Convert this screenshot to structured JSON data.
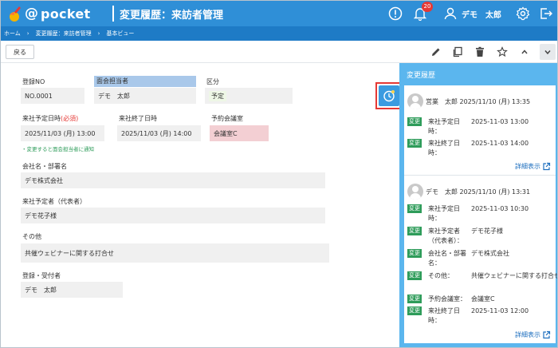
{
  "app": {
    "logo_text": "pocket",
    "logo_at": "@",
    "page_title": "変更履歴：来訪者管理",
    "notification_count": "20",
    "user_name": "デモ　太郎"
  },
  "breadcrumb": [
    "ホーム",
    "変更履歴：来訪者管理",
    "基本ビュー"
  ],
  "toolbar": {
    "back_label": "戻る"
  },
  "form": {
    "reg_no": {
      "label": "登録NO",
      "value": "NO.0001"
    },
    "host": {
      "label": "面会担当者",
      "value": "デモ　太郎"
    },
    "category": {
      "label": "区分",
      "value": "予定"
    },
    "start": {
      "label": "来社予定日時",
      "required": "(必須)",
      "value": "2025/11/03 (月) 13:00"
    },
    "end": {
      "label": "来社終了日時",
      "value": "2025/11/03 (月) 14:00"
    },
    "room": {
      "label": "予約会議室",
      "value": "会議室C"
    },
    "notice": "・変更すると面会担当者に通知",
    "company": {
      "label": "会社名・部署名",
      "value": "デモ株式会社"
    },
    "visitor": {
      "label": "来社予定者（代表者）",
      "value": "デモ花子様"
    },
    "other": {
      "label": "その他",
      "value": "共催ウェビナーに関する打合せ"
    },
    "registrar": {
      "label": "登録・受付者",
      "value": "デモ　太郎"
    }
  },
  "history": {
    "title": "変更履歴",
    "tag_label": "変更",
    "detail_label": "詳細表示",
    "cards": [
      {
        "header": "営業　太郎 2025/11/10 (月) 13:35",
        "items": [
          {
            "key": "来社予定日",
            "key2": "時：",
            "value": "2025-11-03 13:00"
          },
          {
            "key": "来社終了日",
            "key2": "時：",
            "value": "2025-11-03 14:00"
          }
        ]
      },
      {
        "header": "デモ　太郎 2025/11/10 (月) 13:31",
        "items": [
          {
            "key": "来社予定日",
            "key2": "時：",
            "value": "2025-11-03 10:30"
          },
          {
            "key": "来社予定者",
            "key2": "（代表者）：",
            "value": "デモ花子様"
          },
          {
            "key": "会社名・部署",
            "key2": "名：",
            "value": "デモ株式会社"
          },
          {
            "key": "その他：",
            "key2": "",
            "value": "共催ウェビナーに関する打合せ"
          },
          {
            "key": "予約会議室：",
            "key2": "",
            "value": "会議室C"
          },
          {
            "key": "来社終了日",
            "key2": "時：",
            "value": "2025-11-03 12:00"
          }
        ]
      }
    ]
  },
  "colors": {
    "header": "#2f8fd7",
    "breadcrumb": "#1e7bc6",
    "panel": "#5bb6ee",
    "tag": "#2e9c5a",
    "host_label_bg": "#a9c8ea",
    "category_bg": "#eef7e6",
    "room_bg": "#f3cfd3"
  }
}
